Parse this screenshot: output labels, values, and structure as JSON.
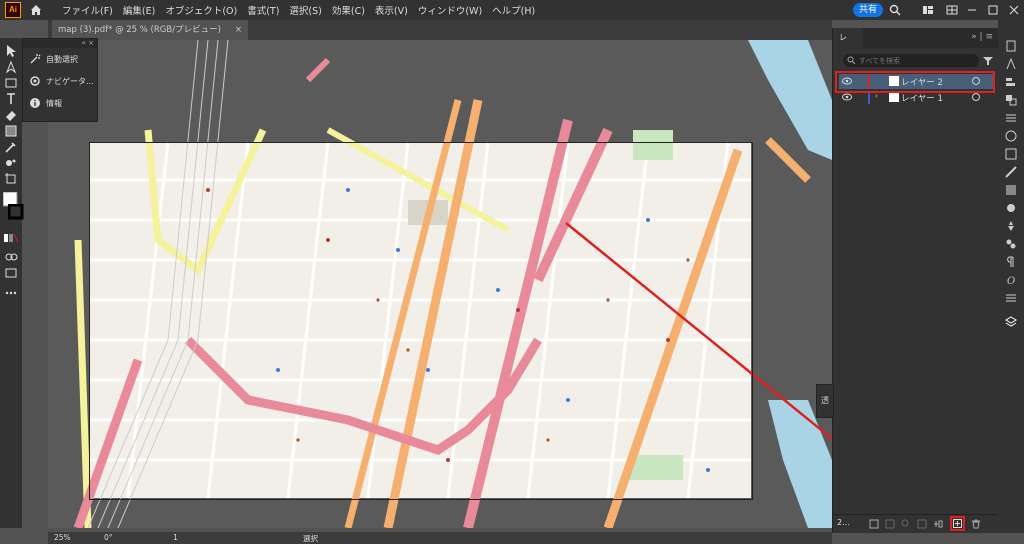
{
  "menu": {
    "app_logo": "Ai",
    "items": [
      "ファイル(F)",
      "編集(E)",
      "オブジェクト(O)",
      "書式(T)",
      "選択(S)",
      "効果(C)",
      "表示(V)",
      "ウィンドウ(W)",
      "ヘルプ(H)"
    ],
    "share_label": "共有"
  },
  "document_tab": {
    "title": "map (3).pdf* @ 25 % (RGB/プレビュー)",
    "close": "×"
  },
  "flyout_panel": {
    "items": [
      {
        "label": "自動選択",
        "icon": "magic-wand-icon"
      },
      {
        "label": "ナビゲータ...",
        "icon": "navigator-icon"
      },
      {
        "label": "情報",
        "icon": "info-icon"
      }
    ]
  },
  "layers_panel": {
    "tab_label": "レ",
    "search_placeholder": "すべてを検索",
    "layers": [
      {
        "name": "レイヤー 2",
        "color": "#e02020",
        "selected": true
      },
      {
        "name": "レイヤー 1",
        "color": "#3b5bdb",
        "selected": false
      }
    ],
    "layer_count": "2..."
  },
  "mini_panel": {
    "label": "透"
  },
  "status": {
    "zoom": "25%",
    "rotation": "0°",
    "artboard": "1",
    "tool": "選択"
  },
  "colors": {
    "highlight_red": "#e02020",
    "road_pink": "#e88a9a",
    "road_orange": "#f5b070",
    "road_yellow": "#f4f29a",
    "water": "#a8d4e6",
    "map_bg": "#f2efe9",
    "park": "#c8e6c0"
  }
}
